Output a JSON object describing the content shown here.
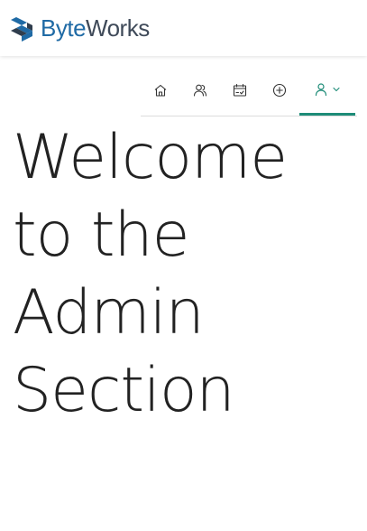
{
  "brand": {
    "name_part1": "Byte",
    "name_part2": "Works",
    "logo_icon": "byteworks-logo-icon",
    "colors": {
      "primary": "#1f6aa5",
      "secondary": "#3f4a59"
    }
  },
  "nav": {
    "items": [
      {
        "icon": "home-icon"
      },
      {
        "icon": "users-icon"
      },
      {
        "icon": "calendar-icon"
      },
      {
        "icon": "add-circle-icon"
      },
      {
        "icon": "user-profile-icon",
        "dropdown_icon": "chevron-down-icon",
        "active": true
      }
    ],
    "active_color": "#1e8c78"
  },
  "main": {
    "heading": "Welcome to the Admin Section"
  }
}
